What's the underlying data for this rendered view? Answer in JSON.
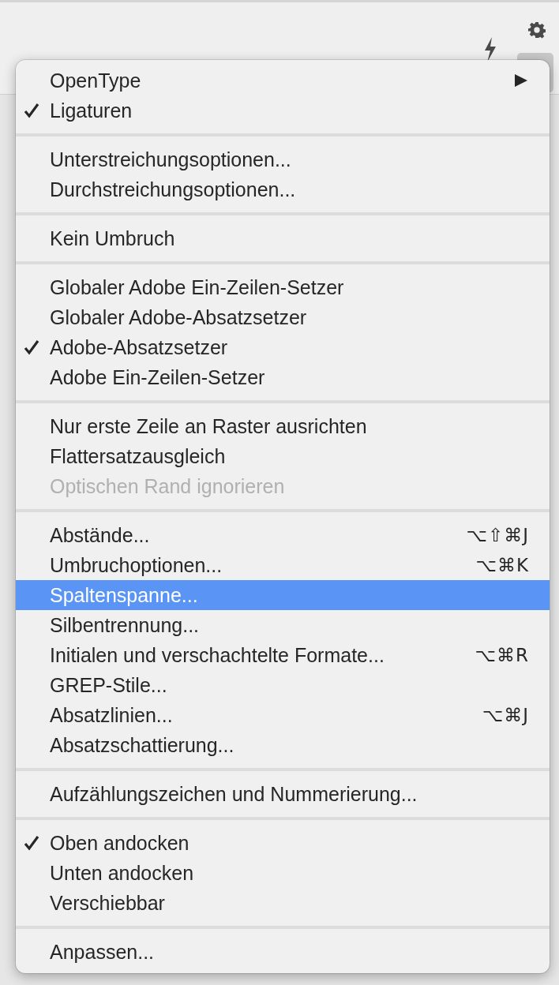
{
  "menu": {
    "sections": [
      {
        "items": [
          {
            "label": "OpenType",
            "checked": false,
            "disabled": false,
            "selected": false,
            "submenu": true
          },
          {
            "label": "Ligaturen",
            "checked": true,
            "disabled": false,
            "selected": false
          }
        ]
      },
      {
        "items": [
          {
            "label": "Unterstreichungsoptionen...",
            "checked": false,
            "disabled": false,
            "selected": false
          },
          {
            "label": "Durchstreichungsoptionen...",
            "checked": false,
            "disabled": false,
            "selected": false
          }
        ]
      },
      {
        "items": [
          {
            "label": "Kein Umbruch",
            "checked": false,
            "disabled": false,
            "selected": false
          }
        ]
      },
      {
        "items": [
          {
            "label": "Globaler Adobe Ein-Zeilen-Setzer",
            "checked": false,
            "disabled": false,
            "selected": false
          },
          {
            "label": "Globaler Adobe-Absatzsetzer",
            "checked": false,
            "disabled": false,
            "selected": false
          },
          {
            "label": "Adobe-Absatzsetzer",
            "checked": true,
            "disabled": false,
            "selected": false
          },
          {
            "label": "Adobe Ein-Zeilen-Setzer",
            "checked": false,
            "disabled": false,
            "selected": false
          }
        ]
      },
      {
        "items": [
          {
            "label": "Nur erste Zeile an Raster ausrichten",
            "checked": false,
            "disabled": false,
            "selected": false
          },
          {
            "label": "Flattersatzausgleich",
            "checked": false,
            "disabled": false,
            "selected": false
          },
          {
            "label": "Optischen Rand ignorieren",
            "checked": false,
            "disabled": true,
            "selected": false
          }
        ]
      },
      {
        "items": [
          {
            "label": "Abstände...",
            "shortcut": "⌥⇧⌘J",
            "checked": false,
            "disabled": false,
            "selected": false
          },
          {
            "label": "Umbruchoptionen...",
            "shortcut": "⌥⌘K",
            "checked": false,
            "disabled": false,
            "selected": false
          },
          {
            "label": "Spaltenspanne...",
            "checked": false,
            "disabled": false,
            "selected": true
          },
          {
            "label": "Silbentrennung...",
            "checked": false,
            "disabled": false,
            "selected": false
          },
          {
            "label": "Initialen und verschachtelte Formate...",
            "shortcut": "⌥⌘R",
            "checked": false,
            "disabled": false,
            "selected": false
          },
          {
            "label": "GREP-Stile...",
            "checked": false,
            "disabled": false,
            "selected": false
          },
          {
            "label": "Absatzlinien...",
            "shortcut": "⌥⌘J",
            "checked": false,
            "disabled": false,
            "selected": false
          },
          {
            "label": "Absatzschattierung...",
            "checked": false,
            "disabled": false,
            "selected": false
          }
        ]
      },
      {
        "items": [
          {
            "label": "Aufzählungszeichen und Nummerierung...",
            "checked": false,
            "disabled": false,
            "selected": false
          }
        ]
      },
      {
        "items": [
          {
            "label": "Oben andocken",
            "checked": true,
            "disabled": false,
            "selected": false
          },
          {
            "label": "Unten andocken",
            "checked": false,
            "disabled": false,
            "selected": false
          },
          {
            "label": "Verschiebbar",
            "checked": false,
            "disabled": false,
            "selected": false
          }
        ]
      },
      {
        "items": [
          {
            "label": "Anpassen...",
            "checked": false,
            "disabled": false,
            "selected": false
          }
        ]
      }
    ]
  }
}
